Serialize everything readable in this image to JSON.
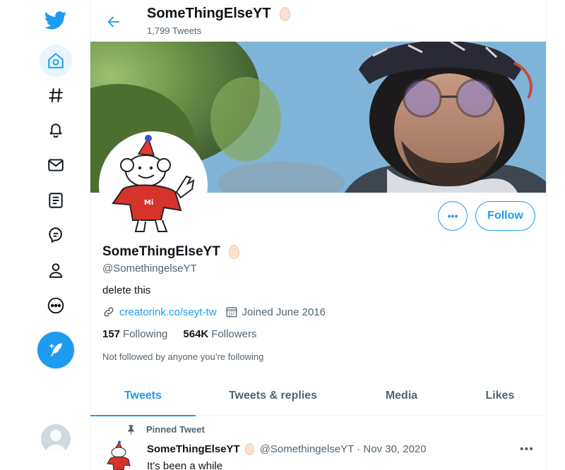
{
  "nav": {
    "items": [
      {
        "icon": "twitter-logo-icon"
      },
      {
        "icon": "home-icon"
      },
      {
        "icon": "explore-hashtag-icon"
      },
      {
        "icon": "notifications-bell-icon"
      },
      {
        "icon": "messages-envelope-icon"
      },
      {
        "icon": "lists-icon"
      },
      {
        "icon": "topics-icon"
      },
      {
        "icon": "profile-icon"
      },
      {
        "icon": "more-icon"
      }
    ],
    "compose_icon": "compose-tweet-icon"
  },
  "header": {
    "name": "SomeThingElseYT",
    "tweet_count": "1,799 Tweets"
  },
  "profile": {
    "display_name": "SomeThingElseYT",
    "handle": "@SomethingelseYT",
    "bio": "delete this",
    "website": "creatorink.co/seyt-tw",
    "joined": "Joined June 2016",
    "following_count": "157",
    "following_label": "Following",
    "followers_count": "564K",
    "followers_label": "Followers",
    "not_followed": "Not followed by anyone you’re following",
    "follow_label": "Follow",
    "more_label": "•••"
  },
  "tabs": [
    "Tweets",
    "Tweets & replies",
    "Media",
    "Likes"
  ],
  "tweet": {
    "pinned_label": "Pinned Tweet",
    "name": "SomeThingElseYT",
    "handle_date": "@SomethingelseYT · Nov 30, 2020",
    "text": "It's been a while",
    "more": "•••"
  },
  "colors": {
    "accent": "#1d9bf0",
    "text": "#0f1419",
    "secondary": "#536471"
  }
}
